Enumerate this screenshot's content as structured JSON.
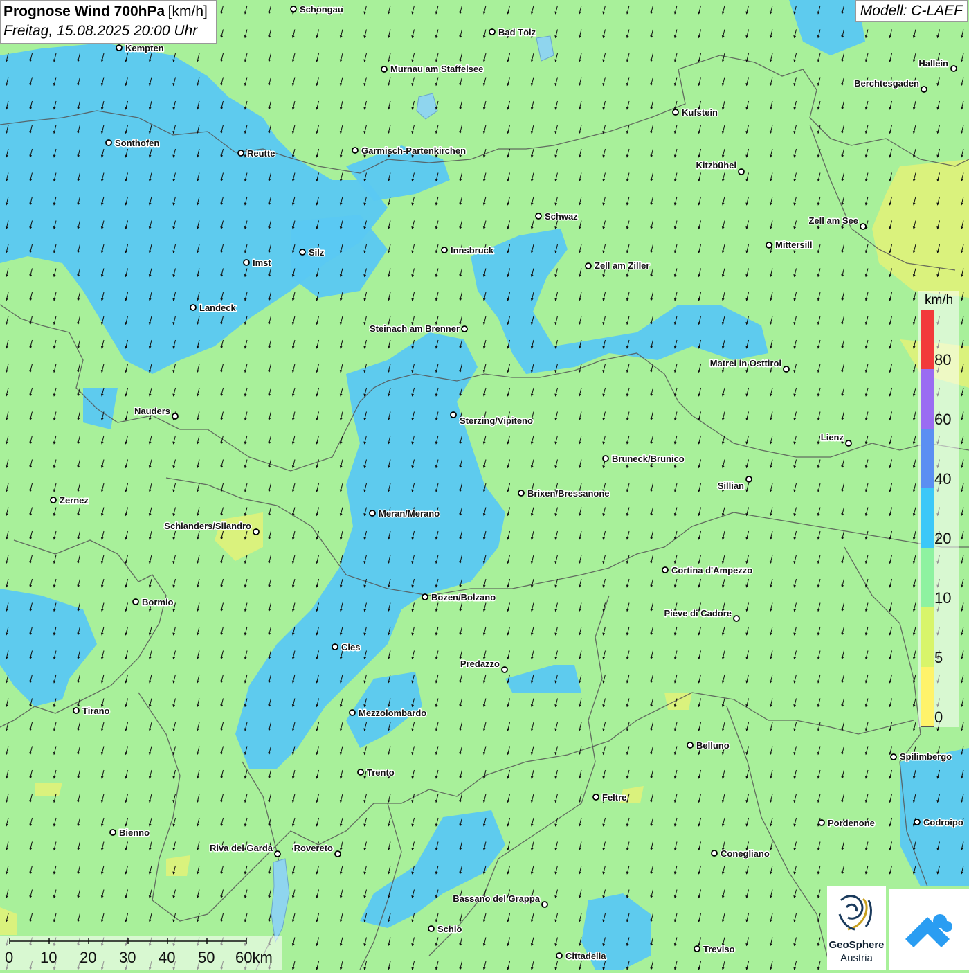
{
  "title": {
    "main": "Prognose Wind 700hPa",
    "unit": "[km/h]",
    "subtitle": "Freitag, 15.08.2025 20:00 Uhr"
  },
  "model": "Modell: C-LAEF",
  "colors": {
    "map_base": "#a8f09a",
    "zone_20_40": "#5ac8f2",
    "zone_5_10": "#dff27a"
  },
  "legend": {
    "unit": "km/h",
    "ticks": [
      "80",
      "60",
      "40",
      "20",
      "10",
      "5",
      "0"
    ],
    "bands": [
      {
        "from": 80,
        "to": null,
        "color": "#f23a3a"
      },
      {
        "from": 60,
        "to": 80,
        "color": "#9a6cf2"
      },
      {
        "from": 40,
        "to": 60,
        "color": "#5b8ff2"
      },
      {
        "from": 20,
        "to": 40,
        "color": "#3cc8f8"
      },
      {
        "from": 10,
        "to": 20,
        "color": "#8ef2a0"
      },
      {
        "from": 5,
        "to": 10,
        "color": "#d8f56a"
      },
      {
        "from": 0,
        "to": 5,
        "color": "#fff36a"
      }
    ]
  },
  "scalebar": {
    "labels": [
      "0",
      "10",
      "20",
      "30",
      "40",
      "50",
      "60km"
    ]
  },
  "logos": {
    "geosphere_line1": "GeoSphere",
    "geosphere_line2": "Austria"
  },
  "wind": {
    "direction": "north-north-east",
    "general_speed_band": "10-20 km/h"
  },
  "cities": [
    {
      "name": "Schongau"
    },
    {
      "name": "Kempten"
    },
    {
      "name": "Bad Tölz"
    },
    {
      "name": "Murnau am Staffelsee"
    },
    {
      "name": "Hallein"
    },
    {
      "name": "Berchtesgaden"
    },
    {
      "name": "Kufstein"
    },
    {
      "name": "Sonthofen"
    },
    {
      "name": "Reutte"
    },
    {
      "name": "Garmisch-Partenkirchen"
    },
    {
      "name": "Kitzbühel"
    },
    {
      "name": "Schwaz"
    },
    {
      "name": "Zell am See"
    },
    {
      "name": "Mittersill"
    },
    {
      "name": "Innsbruck"
    },
    {
      "name": "Imst"
    },
    {
      "name": "Silz"
    },
    {
      "name": "Zell am Ziller"
    },
    {
      "name": "Landeck"
    },
    {
      "name": "Steinach am Brenner"
    },
    {
      "name": "Matrei in Osttirol"
    },
    {
      "name": "Nauders"
    },
    {
      "name": "Sterzing/Vipiteno"
    },
    {
      "name": "Lienz"
    },
    {
      "name": "Bruneck/Brunico"
    },
    {
      "name": "Sillian"
    },
    {
      "name": "Brixen/Bressanone"
    },
    {
      "name": "Zernez"
    },
    {
      "name": "Meran/Merano"
    },
    {
      "name": "Schlanders/Silandro"
    },
    {
      "name": "Cortina d'Ampezzo"
    },
    {
      "name": "Bozen/Bolzano"
    },
    {
      "name": "Bormio"
    },
    {
      "name": "Pieve di Cadore"
    },
    {
      "name": "Cles"
    },
    {
      "name": "Predazzo"
    },
    {
      "name": "Tirano"
    },
    {
      "name": "Mezzolombardo"
    },
    {
      "name": "Belluno"
    },
    {
      "name": "Spilimbergo"
    },
    {
      "name": "Trento"
    },
    {
      "name": "Feltre"
    },
    {
      "name": "Pordenone"
    },
    {
      "name": "Codroipo"
    },
    {
      "name": "Bienno"
    },
    {
      "name": "Riva del Garda"
    },
    {
      "name": "Rovereto"
    },
    {
      "name": "Conegliano"
    },
    {
      "name": "Bassano del Grappa"
    },
    {
      "name": "Schio"
    },
    {
      "name": "Treviso"
    },
    {
      "name": "Cittadella"
    }
  ]
}
